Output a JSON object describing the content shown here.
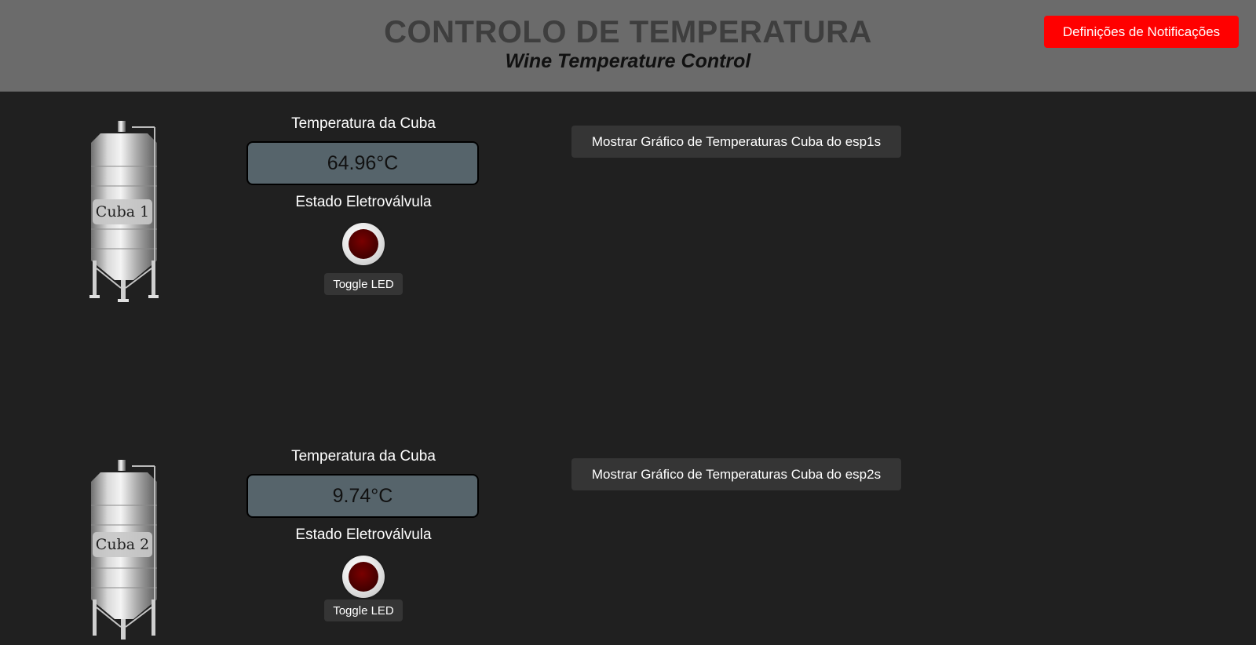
{
  "header": {
    "title": "CONTROLO DE TEMPERATURA",
    "subtitle": "Wine Temperature Control",
    "notifications_button": "Definições de Notificações"
  },
  "colors": {
    "header_bg": "#6b6b6b",
    "page_bg": "#202020",
    "accent_red": "#ff0000",
    "temp_box_bg": "#56646b",
    "led_off": "#4a0000"
  },
  "cubas": [
    {
      "tank_label": "Cuba 1",
      "temp_heading": "Temperatura da Cuba",
      "temperature": "64.96°C",
      "valve_heading": "Estado Eletroválvula",
      "led_state": "off",
      "toggle_label": "Toggle LED",
      "chart_button": "Mostrar Gráfico de Temperaturas Cuba do esp1s"
    },
    {
      "tank_label": "Cuba 2",
      "temp_heading": "Temperatura da Cuba",
      "temperature": "9.74°C",
      "valve_heading": "Estado Eletroválvula",
      "led_state": "off",
      "toggle_label": "Toggle LED",
      "chart_button": "Mostrar Gráfico de Temperaturas Cuba do esp2s"
    }
  ]
}
